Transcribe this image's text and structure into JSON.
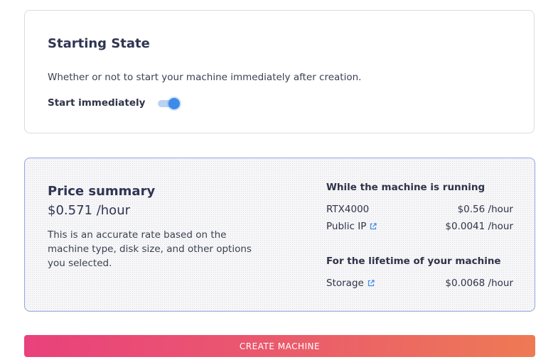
{
  "starting_state": {
    "title": "Starting State",
    "description": "Whether or not to start your machine immediately after creation.",
    "toggle_label": "Start immediately",
    "toggle_on": true
  },
  "price_summary": {
    "title": "Price summary",
    "rate": "$0.571 /hour",
    "note": "This is an accurate rate based on the machine type, disk size, and other options you selected.",
    "running": {
      "title": "While the machine is running",
      "items": [
        {
          "name": "RTX4000",
          "price": "$0.56 /hour",
          "link_icon": false
        },
        {
          "name": "Public IP",
          "price": "$0.0041 /hour",
          "link_icon": true
        }
      ]
    },
    "lifetime": {
      "title": "For the lifetime of your machine",
      "items": [
        {
          "name": "Storage",
          "price": "$0.0068 /hour",
          "link_icon": true
        }
      ]
    }
  },
  "create_button": {
    "label": "CREATE MACHINE"
  },
  "colors": {
    "accent": "#3d8be8",
    "gradient_start": "#e9417c",
    "gradient_end": "#ee7a54",
    "summary_border": "#8fa5e0"
  },
  "icons": {
    "external_link": "external-link-icon"
  }
}
